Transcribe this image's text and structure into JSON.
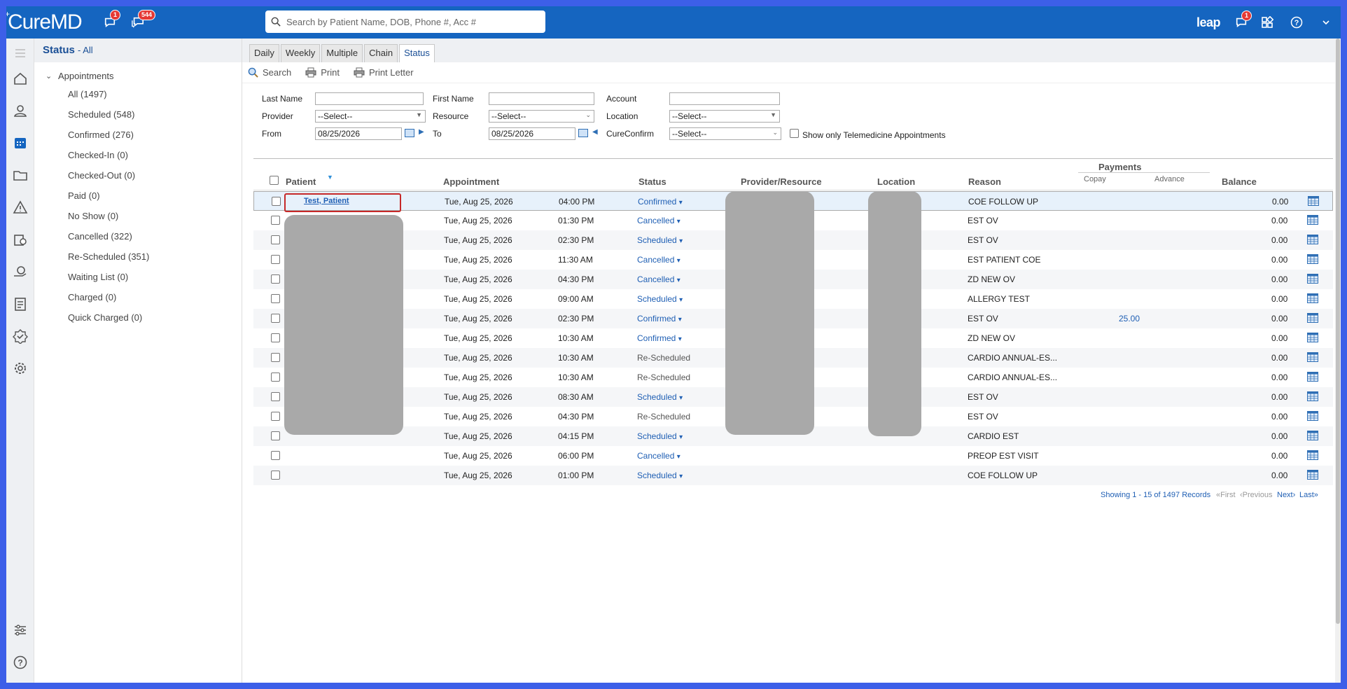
{
  "app": {
    "logo": "CureMD",
    "logo_sup": "+"
  },
  "topbar": {
    "chat_badge": "1",
    "notif_badge": "544",
    "search_placeholder": "Search by Patient Name, DOB, Phone #, Acc #",
    "leap": "leap",
    "right_chat_badge": "1"
  },
  "sidebar": {
    "title": "Status",
    "subtitle": "- All",
    "group": "Appointments",
    "items": [
      "All (1497)",
      "Scheduled (548)",
      "Confirmed (276)",
      "Checked-In (0)",
      "Checked-Out (0)",
      "Paid (0)",
      "No Show (0)",
      "Cancelled (322)",
      "Re-Scheduled (351)",
      "Waiting List (0)",
      "Charged (0)",
      "Quick Charged (0)"
    ]
  },
  "tabs": [
    "Daily",
    "Weekly",
    "Multiple",
    "Chain",
    "Status"
  ],
  "toolbar": {
    "search": "Search",
    "print": "Print",
    "print_letter": "Print Letter"
  },
  "filters": {
    "last_name": "Last Name",
    "first_name": "First Name",
    "account": "Account",
    "provider": "Provider",
    "resource": "Resource",
    "location": "Location",
    "from": "From",
    "to": "To",
    "cureconfirm": "CureConfirm",
    "select": "--Select--",
    "from_date": "08/25/2026",
    "to_date": "08/25/2026",
    "telemedicine": "Show only Telemedicine Appointments"
  },
  "grid": {
    "headers": {
      "patient": "Patient",
      "appointment": "Appointment",
      "status": "Status",
      "provider": "Provider/Resource",
      "location": "Location",
      "reason": "Reason",
      "payments": "Payments",
      "copay": "Copay",
      "advance": "Advance",
      "balance": "Balance"
    },
    "rows": [
      {
        "patient": "Test,  Patient",
        "date": "Tue, Aug 25, 2026",
        "time": "04:00 PM",
        "status": "Confirmed",
        "dd": "▾",
        "reason": "COE FOLLOW UP",
        "copay": "",
        "balance": "0.00"
      },
      {
        "patient": "",
        "date": "Tue, Aug 25, 2026",
        "time": "01:30 PM",
        "status": "Cancelled",
        "dd": "▾",
        "reason": "EST OV",
        "copay": "",
        "balance": "0.00"
      },
      {
        "patient": "",
        "date": "Tue, Aug 25, 2026",
        "time": "02:30 PM",
        "status": "Scheduled",
        "dd": "▾",
        "reason": "EST OV",
        "copay": "",
        "balance": "0.00"
      },
      {
        "patient": "",
        "date": "Tue, Aug 25, 2026",
        "time": "11:30 AM",
        "status": "Cancelled",
        "dd": "▾",
        "reason": "EST PATIENT COE",
        "copay": "",
        "balance": "0.00"
      },
      {
        "patient": "",
        "date": "Tue, Aug 25, 2026",
        "time": "04:30 PM",
        "status": "Cancelled",
        "dd": "▾",
        "reason": "ZD NEW OV",
        "copay": "",
        "balance": "0.00"
      },
      {
        "patient": "",
        "date": "Tue, Aug 25, 2026",
        "time": "09:00 AM",
        "status": "Scheduled",
        "dd": "▾",
        "reason": "ALLERGY TEST",
        "copay": "",
        "balance": "0.00"
      },
      {
        "patient": "",
        "date": "Tue, Aug 25, 2026",
        "time": "02:30 PM",
        "status": "Confirmed",
        "dd": "▾",
        "reason": "EST OV",
        "copay": "25.00",
        "balance": "0.00"
      },
      {
        "patient": "",
        "date": "Tue, Aug 25, 2026",
        "time": "10:30 AM",
        "status": "Confirmed",
        "dd": "▾",
        "reason": "ZD NEW OV",
        "copay": "",
        "balance": "0.00"
      },
      {
        "patient": "",
        "date": "Tue, Aug 25, 2026",
        "time": "10:30 AM",
        "status": "Re-Scheduled",
        "dd": "",
        "reason": "CARDIO ANNUAL-ES...",
        "copay": "",
        "balance": "0.00"
      },
      {
        "patient": "",
        "date": "Tue, Aug 25, 2026",
        "time": "10:30 AM",
        "status": "Re-Scheduled",
        "dd": "",
        "reason": "CARDIO ANNUAL-ES...",
        "copay": "",
        "balance": "0.00"
      },
      {
        "patient": "",
        "date": "Tue, Aug 25, 2026",
        "time": "08:30 AM",
        "status": "Scheduled",
        "dd": "▾",
        "reason": "EST OV",
        "copay": "",
        "balance": "0.00"
      },
      {
        "patient": "",
        "date": "Tue, Aug 25, 2026",
        "time": "04:30 PM",
        "status": "Re-Scheduled",
        "dd": "",
        "reason": "EST OV",
        "copay": "",
        "balance": "0.00"
      },
      {
        "patient": "",
        "date": "Tue, Aug 25, 2026",
        "time": "04:15 PM",
        "status": "Scheduled",
        "dd": "▾",
        "reason": "CARDIO EST",
        "copay": "",
        "balance": "0.00"
      },
      {
        "patient": "",
        "date": "Tue, Aug 25, 2026",
        "time": "06:00 PM",
        "status": "Cancelled",
        "dd": "▾",
        "reason": "PREOP EST VISIT",
        "copay": "",
        "balance": "0.00"
      },
      {
        "patient": "",
        "date": "Tue, Aug 25, 2026",
        "time": "01:00 PM",
        "status": "Scheduled",
        "dd": "▾",
        "reason": "COE FOLLOW UP",
        "copay": "",
        "balance": "0.00"
      }
    ]
  },
  "pager": {
    "showing": "Showing 1 - 15 of 1497 Records",
    "first": "First",
    "previous": "Previous",
    "next": "Next",
    "last": "Last"
  },
  "colors": {
    "brand": "#1565c0",
    "frame": "#3d5fe8",
    "link": "#1f5fb4"
  }
}
